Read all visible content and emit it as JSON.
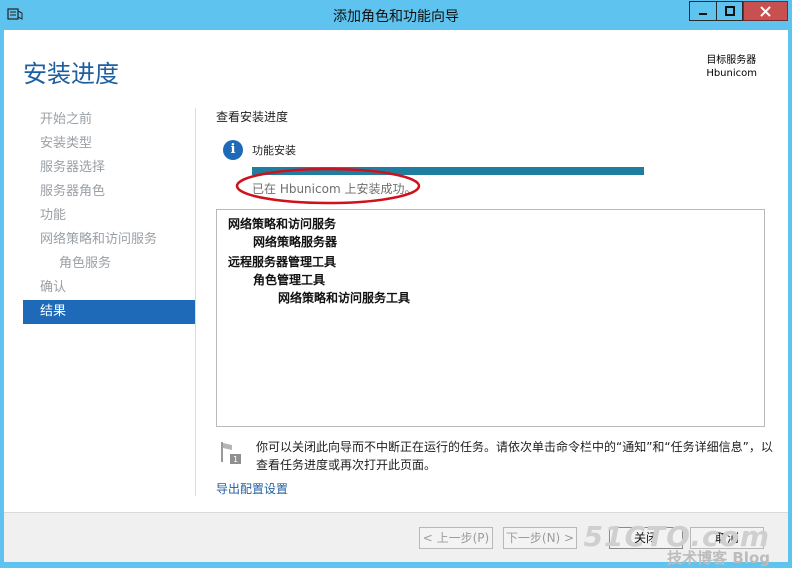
{
  "window": {
    "title": "添加角色和功能向导"
  },
  "header": {
    "page_title": "安装进度",
    "dest_label": "目标服务器",
    "dest_server": "Hbunicom"
  },
  "nav": {
    "items": [
      {
        "label": "开始之前"
      },
      {
        "label": "安装类型"
      },
      {
        "label": "服务器选择"
      },
      {
        "label": "服务器角色"
      },
      {
        "label": "功能"
      },
      {
        "label": "网络策略和访问服务"
      },
      {
        "label": "角色服务"
      },
      {
        "label": "确认"
      },
      {
        "label": "结果"
      }
    ]
  },
  "main": {
    "section_title": "查看安装进度",
    "status_label": "功能安装",
    "progress": 1.0,
    "success_text": "已在 Hbunicom 上安装成功。",
    "results": [
      "网络策略和访问服务",
      "网络策略服务器",
      "远程服务器管理工具",
      "角色管理工具",
      "网络策略和访问服务工具"
    ],
    "footnote": "你可以关闭此向导而不中断正在运行的任务。请依次单击命令栏中的“通知”和“任务详细信息”，以查看任务进度或再次打开此页面。",
    "export_link": "导出配置设置"
  },
  "footer": {
    "prev_label": "< 上一步(P)",
    "next_label": "下一步(N) >",
    "close_label": "关闭",
    "cancel_label": "取消"
  },
  "watermark": {
    "main": "51CTO.com",
    "sub": "技术博客 Blog"
  },
  "colors": {
    "accent": "#1e6ab8",
    "frame": "#5ec3ee",
    "progress": "#1f7ea0",
    "annotation": "#d0101a"
  }
}
